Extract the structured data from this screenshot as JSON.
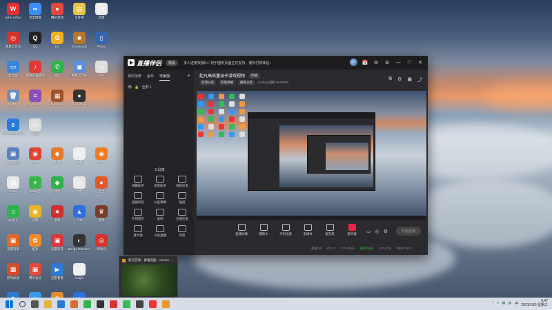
{
  "desktop": {
    "icons": [
      {
        "label": "WPS Office",
        "glyph": "W",
        "color": "#e52e2e"
      },
      {
        "label": "百度网盘",
        "glyph": "∞",
        "color": "#3a8ff5"
      },
      {
        "label": "腾讯游戏",
        "glyph": "●",
        "color": "#e14a3a"
      },
      {
        "label": "文件夹",
        "glyph": "▤",
        "color": "#e7c24a"
      },
      {
        "label": "新建",
        "glyph": "▭",
        "color": "#eeeeee"
      },
      {
        "label": "网易云音乐",
        "glyph": "◎",
        "color": "#d8322c"
      },
      {
        "label": "QQ",
        "glyph": "Q",
        "color": "#222222"
      },
      {
        "label": "UU",
        "glyph": "G",
        "color": "#f0b21c"
      },
      {
        "label": "Downloads",
        "glyph": "■",
        "color": "#b5762e"
      },
      {
        "label": "Phone",
        "glyph": "▯",
        "color": "#3766b0"
      },
      {
        "label": "此电脑",
        "glyph": "▭",
        "color": "#3a87d9"
      },
      {
        "label": "网易有道翻译",
        "glyph": "♪",
        "color": "#dd3a3a"
      },
      {
        "label": "微信",
        "glyph": "✆",
        "color": "#2fb34a"
      },
      {
        "label": "网易云音乐",
        "glyph": "▣",
        "color": "#5b8fd8"
      },
      {
        "label": "MP4",
        "glyph": "▭",
        "color": "#dddddd"
      },
      {
        "label": "回收站",
        "glyph": "🗑",
        "color": "#6d8fb8"
      },
      {
        "label": "WinRAR",
        "glyph": "≡",
        "color": "#8a4fb5"
      },
      {
        "label": "WinRAR",
        "glyph": "▦",
        "color": "#a0522d"
      },
      {
        "label": "Everything",
        "glyph": "●",
        "color": "#333333"
      },
      {
        "label": "",
        "glyph": "",
        "color": "transparent"
      },
      {
        "label": "Microsoft Edge",
        "glyph": "e",
        "color": "#2a7ad8"
      },
      {
        "label": "迅雷",
        "glyph": "▭",
        "color": "#dddddd"
      },
      {
        "label": "",
        "glyph": "",
        "color": "transparent"
      },
      {
        "label": "",
        "glyph": "",
        "color": "transparent"
      },
      {
        "label": "",
        "glyph": "",
        "color": "transparent"
      },
      {
        "label": "控制面板",
        "glyph": "▣",
        "color": "#5b7fc0"
      },
      {
        "label": "360",
        "glyph": "◉",
        "color": "#dd4433"
      },
      {
        "label": "火绒",
        "glyph": "◆",
        "color": "#e77a2b"
      },
      {
        "label": "文档",
        "glyph": "▭",
        "color": "#eeeeee"
      },
      {
        "label": "Origin",
        "glyph": "◉",
        "color": "#f07a22"
      },
      {
        "label": "Excel",
        "glyph": "▤",
        "color": "#e8e8e8"
      },
      {
        "label": "360安全",
        "glyph": "+",
        "color": "#3ab54a"
      },
      {
        "label": "绿色",
        "glyph": "◆",
        "color": "#2fb34a"
      },
      {
        "label": "文档",
        "glyph": "▭",
        "color": "#e8e8e8"
      },
      {
        "label": "定位",
        "glyph": "●",
        "color": "#e05a2a"
      },
      {
        "label": "QQ音乐",
        "glyph": "♫",
        "color": "#2cb44a"
      },
      {
        "label": "谷歌",
        "glyph": "◉",
        "color": "#e7b628"
      },
      {
        "label": "游戏",
        "glyph": "★",
        "color": "#d03030"
      },
      {
        "label": "飞书",
        "glyph": "▲",
        "color": "#2f6fe0"
      },
      {
        "label": "游戏",
        "glyph": "♛",
        "color": "#7a3a2a"
      },
      {
        "label": "流量管家",
        "glyph": "▣",
        "color": "#e06a2a"
      },
      {
        "label": "酷狗",
        "glyph": "✿",
        "color": "#f28a2b"
      },
      {
        "label": "迅雷影音",
        "glyph": "▣",
        "color": "#d83a3a"
      },
      {
        "label": "Bongo Cat Mver",
        "glyph": "◐",
        "color": "#333333"
      },
      {
        "label": "网易云",
        "glyph": "◎",
        "color": "#d8322c"
      },
      {
        "label": "游戏加速",
        "glyph": "▦",
        "color": "#d0502a"
      },
      {
        "label": "腾讯会议",
        "glyph": "▣",
        "color": "#e04a3a"
      },
      {
        "label": "迅雷看看",
        "glyph": "▶",
        "color": "#2a7ad8"
      },
      {
        "label": "Origin",
        "glyph": "▭",
        "color": "#f0f0f0"
      },
      {
        "label": "",
        "glyph": "",
        "color": "transparent"
      },
      {
        "label": "鲁大师",
        "glyph": "☻",
        "color": "#2a7ad8"
      },
      {
        "label": "QQ浏览器",
        "glyph": "●",
        "color": "#3a9ae8"
      },
      {
        "label": "CFHD管理",
        "glyph": "◉",
        "color": "#e88a2a"
      },
      {
        "label": "腾讯会议",
        "glyph": "▲",
        "color": "#2f6fe0"
      }
    ]
  },
  "app": {
    "title": "直播伴侣",
    "version": "新版",
    "notice": "多人连麦安装6人 将于圆形页面正式支持，邀你付费体验 ›",
    "title_icons": [
      "📅",
      "✉",
      "⚙",
      "—",
      "□",
      "✕"
    ]
  },
  "sidebar": {
    "tabs": [
      "我的场景",
      "画布",
      "可添加"
    ],
    "active_tab": "可添加",
    "add": "+",
    "scene_row": "全屏 1",
    "tools_title": "工具箱",
    "tools": [
      "弹幕助手",
      "房管助手",
      "视频连麦",
      "直播风控",
      "斗鱼弹幕",
      "贴纸",
      "礼物提示",
      "录制",
      "主播连麦",
      "放大镜",
      "小色直播",
      "场景"
    ],
    "bottom_note": "小色直播伴侣使用教程"
  },
  "main": {
    "title": "起凡高效量派子游戏视频",
    "title_badge": "停播",
    "sub_pills": [
      "新增分类",
      "新版弹幕"
    ],
    "sub_btn": "播客分类",
    "sub_text": "Anyhow  圆形  8475060",
    "icons": [
      "⧉",
      "⚙",
      "▣",
      "⤴"
    ],
    "controls": [
      "直播屏幕",
      "摄像头",
      "手机投屏",
      "多媒体",
      "麦克风",
      "扬声器"
    ],
    "right_icons": [
      "▭",
      "◎",
      "⚙"
    ],
    "start_label": "开始直播",
    "status": [
      "直播:3h",
      "码:1.2",
      "CPU:45%",
      "内存:54%",
      "GPU:0%",
      "帧:60 FPS"
    ]
  },
  "thumbnail": {
    "title": "起凡游戏：群雄逐鹿 - version..."
  },
  "taskbar": {
    "time": "6:47",
    "date": "2021/10/6 星期三",
    "lang": "中"
  }
}
